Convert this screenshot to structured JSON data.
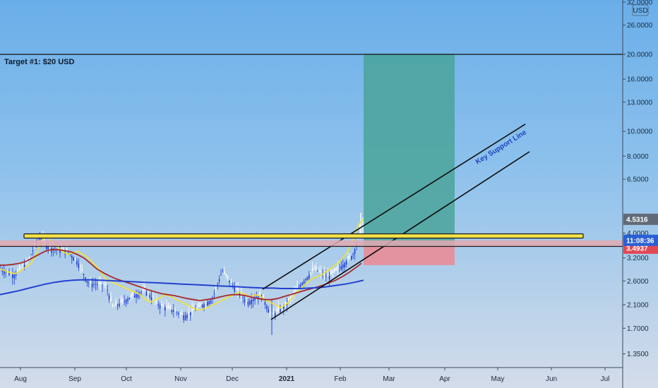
{
  "chart_data": {
    "type": "line",
    "title": "",
    "currency": "USD",
    "y_scale": "log",
    "ylim": [
      1.2,
      36
    ],
    "y_ticks": [
      "32.0000",
      "26.0000",
      "20.0000",
      "16.0000",
      "13.0000",
      "10.0000",
      "8.0000",
      "6.5000",
      "4.0000",
      "3.2000",
      "2.6000",
      "2.1000",
      "1.7000",
      "1.3500"
    ],
    "x_ticks": [
      "Aug",
      "Sep",
      "Oct",
      "Nov",
      "Dec",
      "2021",
      "Feb",
      "Mar",
      "Apr",
      "May",
      "Jun",
      "Jul"
    ],
    "price_labels": [
      {
        "text": "4.5316",
        "value": 4.5316,
        "color": "#616b78"
      },
      {
        "text": "3.4937",
        "value": 3.4937,
        "color": "#e04a55"
      },
      {
        "text": "11:08:36",
        "value": 3.75,
        "color": "#2b5fd4"
      }
    ],
    "annotations": [
      "Target #1: $20 USD",
      "Key Support Line"
    ],
    "horizontal_lines": [
      20,
      3.55
    ],
    "series": [
      {
        "values": [
          2.9,
          2.85,
          2.8,
          2.78,
          2.85,
          2.95,
          3.05,
          3.3,
          3.75,
          3.9,
          3.7,
          3.55,
          3.4,
          3.3,
          3.35,
          3.4,
          3.3,
          3.2,
          3.05,
          2.9,
          2.7,
          2.6,
          2.55,
          2.5,
          2.45,
          2.4,
          2.35,
          2.3,
          2.2,
          2.15,
          2.2,
          2.25,
          2.3,
          2.25,
          2.2,
          2.15,
          2.1,
          2.05,
          2.0,
          2.02,
          2.05,
          2.1,
          2.15,
          2.2,
          2.25,
          2.3,
          2.35,
          2.32,
          2.25,
          2.3,
          2.28,
          2.2,
          2.15,
          2.1,
          2.05,
          2.1,
          2.2,
          2.35,
          2.45,
          2.55,
          2.65,
          2.7,
          2.75,
          2.85,
          2.95,
          3.05,
          3.2,
          3.4,
          3.8,
          4.3,
          4.55
        ],
        "color": "#f0e040"
      },
      {
        "values": [
          3.0,
          3.0,
          3.02,
          3.05,
          3.1,
          3.2,
          3.3,
          3.4,
          3.45,
          3.45,
          3.42,
          3.38,
          3.3,
          3.2,
          3.05,
          2.9,
          2.8,
          2.72,
          2.65,
          2.6,
          2.55,
          2.5,
          2.45,
          2.4,
          2.36,
          2.32,
          2.3,
          2.28,
          2.25,
          2.22,
          2.2,
          2.18,
          2.2,
          2.22,
          2.25,
          2.28,
          2.3,
          2.3,
          2.28,
          2.25,
          2.22,
          2.2,
          2.2,
          2.22,
          2.26,
          2.3,
          2.34,
          2.38,
          2.42,
          2.46,
          2.5,
          2.56,
          2.62,
          2.7,
          2.8,
          2.92,
          3.05
        ],
        "color": "#a82a2a"
      },
      {
        "values": [
          2.3,
          2.34,
          2.38,
          2.43,
          2.48,
          2.53,
          2.57,
          2.6,
          2.62,
          2.63,
          2.63,
          2.62,
          2.61,
          2.6,
          2.59,
          2.58,
          2.57,
          2.56,
          2.55,
          2.54,
          2.53,
          2.52,
          2.51,
          2.5,
          2.49,
          2.48,
          2.47,
          2.46,
          2.45,
          2.44,
          2.44,
          2.43,
          2.43,
          2.43,
          2.44,
          2.45,
          2.47,
          2.5,
          2.53,
          2.57,
          2.62
        ],
        "color": "#2340d0"
      }
    ]
  }
}
